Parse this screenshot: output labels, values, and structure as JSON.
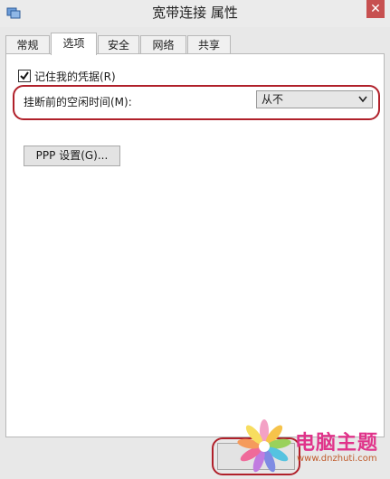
{
  "window": {
    "title": "宽带连接 属性",
    "close_glyph": "✕"
  },
  "tabs": [
    {
      "label": "常规",
      "active": false
    },
    {
      "label": "选项",
      "active": true
    },
    {
      "label": "安全",
      "active": false
    },
    {
      "label": "网络",
      "active": false
    },
    {
      "label": "共享",
      "active": false
    }
  ],
  "options": {
    "remember_credentials": {
      "label": "记住我的凭据(R)",
      "checked": true
    },
    "idle_time": {
      "label": "挂断前的空闲时间(M):",
      "selected": "从不"
    },
    "ppp_button": "PPP 设置(G)..."
  },
  "watermark": {
    "brand": "电脑主题",
    "url": "www.dnzhuti.com"
  },
  "colors": {
    "highlight": "#b0202a",
    "watermark_brand": "#e0338a"
  }
}
